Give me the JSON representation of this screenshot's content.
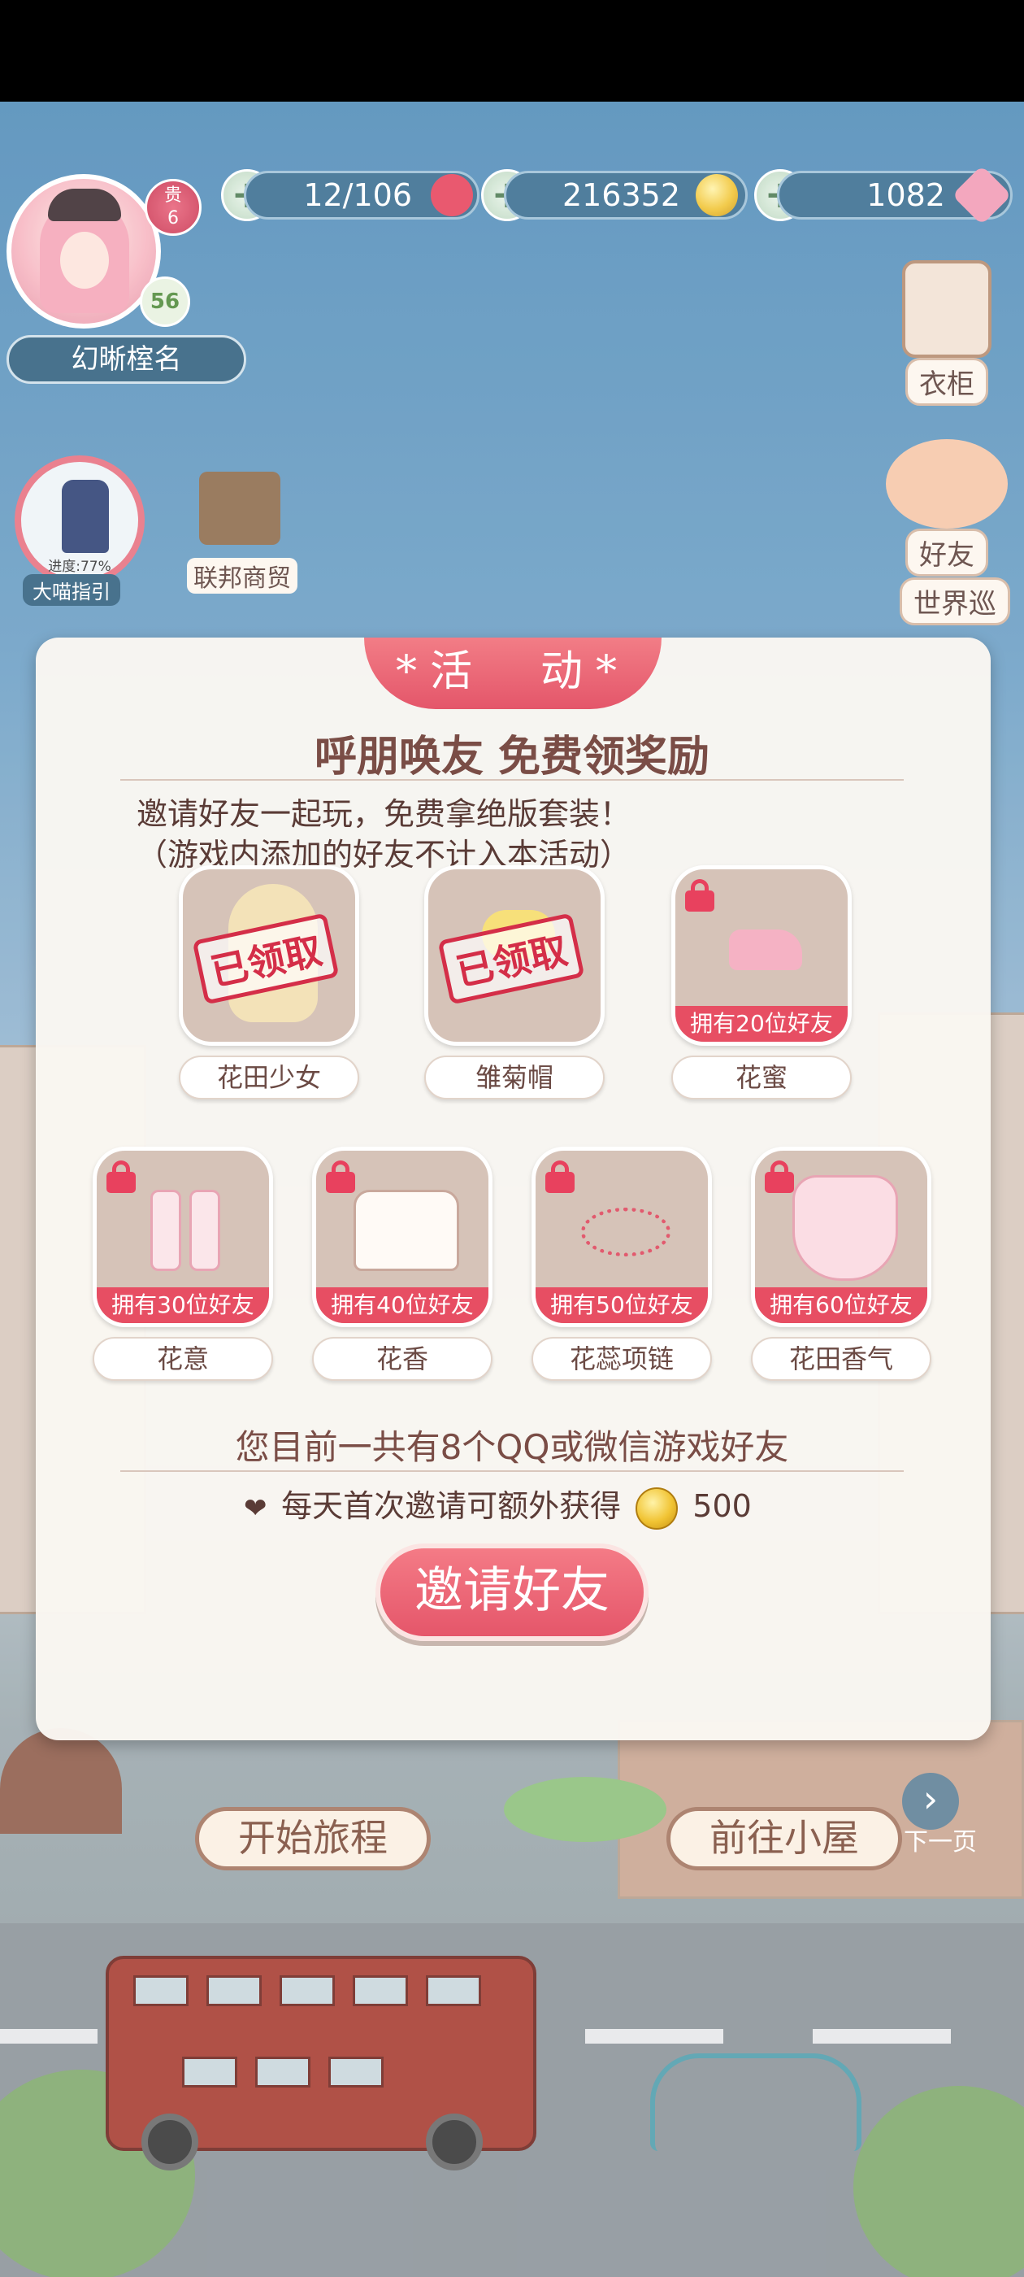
{
  "header": {
    "player_name": "幻晰榁名",
    "vip_label": "贵",
    "vip_level": "6",
    "player_level": "56",
    "resources": [
      {
        "name": "stamina",
        "value": "12/106",
        "icon": "heart-icon",
        "color": "#e6435c"
      },
      {
        "name": "gold",
        "value": "216352",
        "icon": "gold-coin-icon",
        "color": "#f1c434"
      },
      {
        "name": "diamond",
        "value": "1082",
        "icon": "pink-diamond-icon",
        "color": "#f29bb5"
      }
    ]
  },
  "left_menu": {
    "guide_progress": "进度:77%",
    "guide_label": "大喵指引",
    "trade_label": "联邦商贸"
  },
  "right_menu": {
    "wardrobe_label": "衣柜",
    "friends_label": "好友",
    "world_label": "世界巡"
  },
  "scene": {
    "start_journey": "开始旅程",
    "go_house": "前往小屋",
    "next_page": "下一页"
  },
  "modal": {
    "tab_label": "*活　动*",
    "title": "呼朋唤友 免费领奖励",
    "desc_line1": "邀请好友一起玩，免费拿绝版套装！",
    "desc_line2": "（游戏内添加的好友不计入本活动）",
    "rewards": [
      {
        "name": "花田少女",
        "status": "已领取",
        "locked": false
      },
      {
        "name": "雏菊帽",
        "status": "已领取",
        "locked": false
      },
      {
        "name": "花蜜",
        "status": "拥有20位好友",
        "locked": true
      },
      {
        "name": "花意",
        "status": "拥有30位好友",
        "locked": true
      },
      {
        "name": "花香",
        "status": "拥有40位好友",
        "locked": true
      },
      {
        "name": "花蕊项链",
        "status": "拥有50位好友",
        "locked": true
      },
      {
        "name": "花田香气",
        "status": "拥有60位好友",
        "locked": true
      }
    ],
    "friend_count_text": "您目前一共有8个QQ或微信游戏好友",
    "bonus_text": "每天首次邀请可额外获得",
    "bonus_amount": "500",
    "invite_button": "邀请好友"
  }
}
